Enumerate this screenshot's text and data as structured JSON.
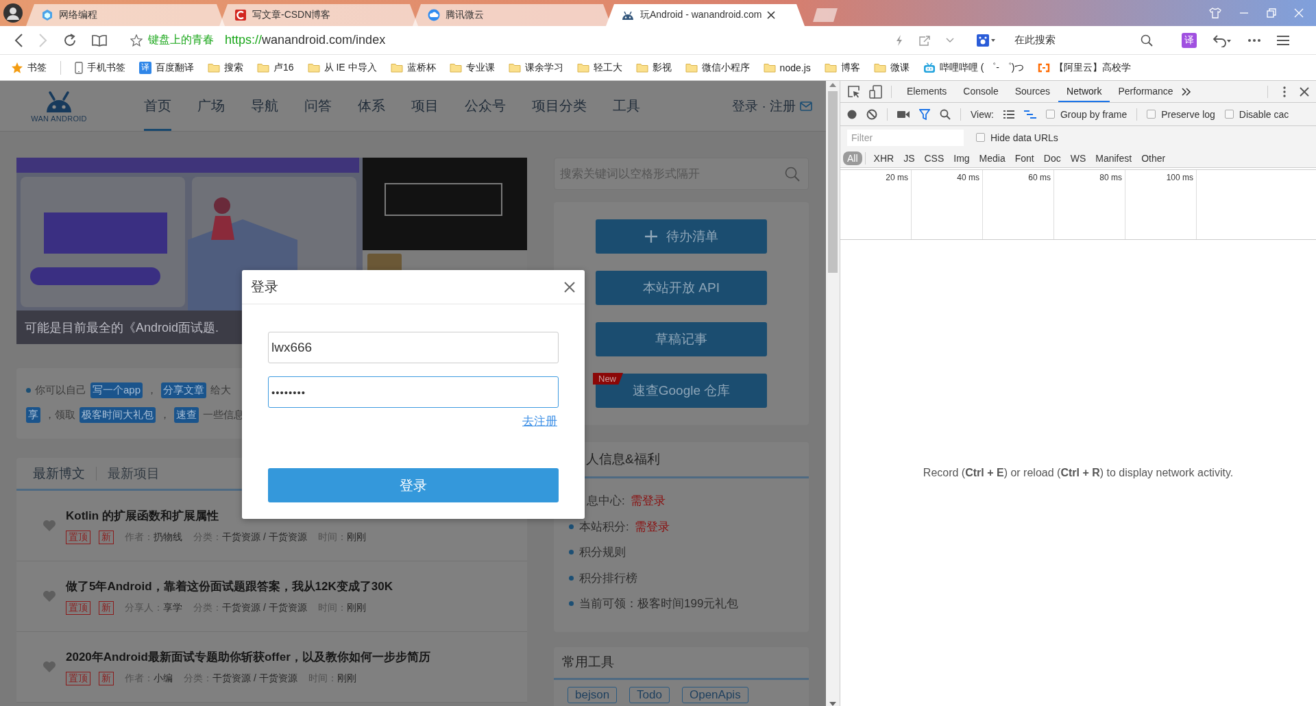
{
  "browser": {
    "tabs": [
      {
        "title": "网络编程",
        "kind": "cube",
        "selected": false
      },
      {
        "title": "写文章-CSDN博客",
        "kind": "csdn",
        "selected": false
      },
      {
        "title": "腾讯微云",
        "kind": "cloud",
        "selected": false
      },
      {
        "title": "玩Android - wanandroid.com",
        "kind": "android",
        "selected": true
      }
    ],
    "address": {
      "site_name": "键盘上的青春",
      "scheme": "https://",
      "rest": "wanandroid.com/index"
    },
    "search": {
      "placeholder": "在此搜索"
    },
    "translate_button": "译",
    "bookmarks": [
      {
        "label": "书签",
        "kind": "star"
      },
      {
        "label": "手机书签",
        "kind": "phone"
      },
      {
        "label": "百度翻译",
        "kind": "badge",
        "badge": "译"
      },
      {
        "label": "搜索",
        "kind": "folder"
      },
      {
        "label": "卢16",
        "kind": "folder"
      },
      {
        "label": "从 IE 中导入",
        "kind": "folder"
      },
      {
        "label": "蓝桥杯",
        "kind": "folder"
      },
      {
        "label": "专业课",
        "kind": "folder"
      },
      {
        "label": "课余学习",
        "kind": "folder"
      },
      {
        "label": "轻工大",
        "kind": "folder"
      },
      {
        "label": "影视",
        "kind": "folder"
      },
      {
        "label": "微信小程序",
        "kind": "folder"
      },
      {
        "label": "node.js",
        "kind": "folder"
      },
      {
        "label": "博客",
        "kind": "folder"
      },
      {
        "label": "微课",
        "kind": "folder"
      },
      {
        "label": "哔哩哔哩 ( ゜- ゜)つ",
        "kind": "tv"
      },
      {
        "label": "【阿里云】高校学",
        "kind": "bracket"
      }
    ]
  },
  "page": {
    "logo": "WAN ANDROID",
    "nav": [
      {
        "label": "首页",
        "selected": true
      },
      {
        "label": "广场",
        "selected": false
      },
      {
        "label": "导航",
        "selected": false
      },
      {
        "label": "问答",
        "selected": false
      },
      {
        "label": "体系",
        "selected": false
      },
      {
        "label": "项目",
        "selected": false
      },
      {
        "label": "公众号",
        "selected": false
      },
      {
        "label": "项目分类",
        "selected": false
      },
      {
        "label": "工具",
        "selected": false
      }
    ],
    "auth_link": "登录 · 注册",
    "banner": {
      "kind": "picture",
      "caption": "可能是目前最全的《Android面试题."
    },
    "notice": [
      {
        "bullet": true,
        "segments": [
          {
            "kind": "text",
            "text": "你可以自己"
          },
          {
            "kind": "tag",
            "text": "写一个app"
          },
          {
            "kind": "text",
            "text": "，"
          },
          {
            "kind": "tag",
            "text": "分享文章"
          },
          {
            "kind": "text",
            "text": "给大"
          }
        ]
      },
      {
        "bullet": false,
        "segments": [
          {
            "kind": "tag",
            "text": "享"
          },
          {
            "kind": "text",
            "text": "，领取"
          },
          {
            "kind": "tag",
            "text": "极客时间大礼包"
          },
          {
            "kind": "text",
            "text": "，"
          },
          {
            "kind": "tag",
            "text": "速查"
          },
          {
            "kind": "text",
            "text": "一些信息"
          }
        ]
      }
    ],
    "article_tabs": [
      {
        "label": "最新博文",
        "selected": true
      },
      {
        "label": "最新项目",
        "selected": false
      }
    ],
    "articles": [
      {
        "title": "Kotlin 的扩展函数和扩展属性",
        "tags": [
          "置顶",
          "新"
        ],
        "meta": [
          {
            "label": "作者：",
            "value": "扔物线"
          },
          {
            "label": "分类：",
            "value": "干货资源 / 干货资源"
          },
          {
            "label": "时间：",
            "value": "刚刚"
          }
        ]
      },
      {
        "title": "做了5年Android，靠着这份面试题跟答案，我从12K变成了30K",
        "tags": [
          "置顶",
          "新"
        ],
        "meta": [
          {
            "label": "分享人：",
            "value": "享学"
          },
          {
            "label": "分类：",
            "value": "干货资源 / 干货资源"
          },
          {
            "label": "时间：",
            "value": "刚刚"
          }
        ]
      },
      {
        "title": "2020年Android最新面试专题助你斩获offer，以及教你如何一步步简历",
        "tags": [
          "置顶",
          "新"
        ],
        "meta": [
          {
            "label": "作者：",
            "value": "小编"
          },
          {
            "label": "分类：",
            "value": "干货资源 / 干货资源"
          },
          {
            "label": "时间：",
            "value": "刚刚"
          }
        ]
      }
    ],
    "search": {
      "placeholder": "搜索关键词以空格形式隔开"
    },
    "actions": [
      {
        "label": "待办清单",
        "kind": "add"
      },
      {
        "label": "本站开放 API",
        "kind": "plain"
      },
      {
        "label": "草稿记事",
        "kind": "plain"
      },
      {
        "label": "速查Google 仓库",
        "kind": "plain",
        "badge": "New"
      }
    ],
    "profile": {
      "title": "人信息&福利",
      "items": [
        {
          "label": "息中心:",
          "status": "需登录",
          "bullet": false
        },
        {
          "label": "本站积分:",
          "status": "需登录",
          "bullet": true
        },
        {
          "label": "积分规则",
          "bullet": true
        },
        {
          "label": "积分排行榜",
          "bullet": true
        },
        {
          "label": "当前可领：极客时间199元礼包",
          "bullet": true
        }
      ]
    },
    "tools": {
      "title": "常用工具",
      "tags": [
        "bejson",
        "Todo",
        "OpenApis"
      ]
    }
  },
  "dialog": {
    "title": "登录",
    "username": "lwx666",
    "password": "••••••••",
    "register_link": "去注册",
    "submit": "登录"
  },
  "devtools": {
    "tabs": [
      {
        "label": "Elements",
        "selected": false
      },
      {
        "label": "Console",
        "selected": false
      },
      {
        "label": "Sources",
        "selected": false
      },
      {
        "label": "Network",
        "selected": true
      },
      {
        "label": "Performance",
        "selected": false
      }
    ],
    "view_label": "View:",
    "options": [
      {
        "label": "Group by frame",
        "checked": false
      },
      {
        "label": "Preserve log",
        "checked": false
      },
      {
        "label": "Disable cac",
        "checked": false
      }
    ],
    "filter": {
      "placeholder": "Filter"
    },
    "hide_data_urls": {
      "label": "Hide data URLs",
      "checked": false
    },
    "types": [
      {
        "label": "All",
        "selected": true
      },
      {
        "label": "XHR",
        "selected": false
      },
      {
        "label": "JS",
        "selected": false
      },
      {
        "label": "CSS",
        "selected": false
      },
      {
        "label": "Img",
        "selected": false
      },
      {
        "label": "Media",
        "selected": false
      },
      {
        "label": "Font",
        "selected": false
      },
      {
        "label": "Doc",
        "selected": false
      },
      {
        "label": "WS",
        "selected": false
      },
      {
        "label": "Manifest",
        "selected": false
      },
      {
        "label": "Other",
        "selected": false
      }
    ],
    "timeline_ticks": [
      "20 ms",
      "40 ms",
      "60 ms",
      "80 ms",
      "100 ms"
    ],
    "message": "Record (**Ctrl + E**) or reload (**Ctrl + R**) to display network activity."
  }
}
